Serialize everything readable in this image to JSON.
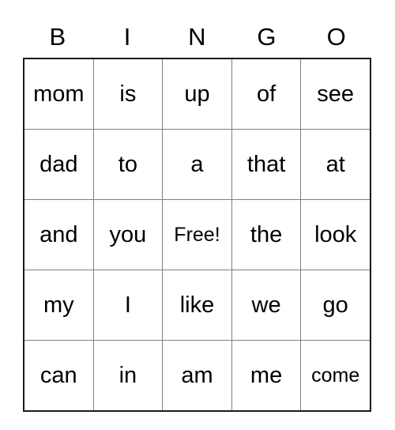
{
  "card": {
    "type": "bingo-card",
    "headers": [
      "B",
      "I",
      "N",
      "G",
      "O"
    ],
    "rows": [
      [
        "mom",
        "is",
        "up",
        "of",
        "see"
      ],
      [
        "dad",
        "to",
        "a",
        "that",
        "at"
      ],
      [
        "and",
        "you",
        "Free!",
        "the",
        "look"
      ],
      [
        "my",
        "I",
        "like",
        "we",
        "go"
      ],
      [
        "can",
        "in",
        "am",
        "me",
        "come"
      ]
    ],
    "free_space": {
      "row": 2,
      "col": 2,
      "label": "Free!"
    },
    "colors": {
      "background": "#ffffff",
      "text": "#000000",
      "outer_border": "#1a1a1a",
      "inner_border": "#808080"
    }
  }
}
